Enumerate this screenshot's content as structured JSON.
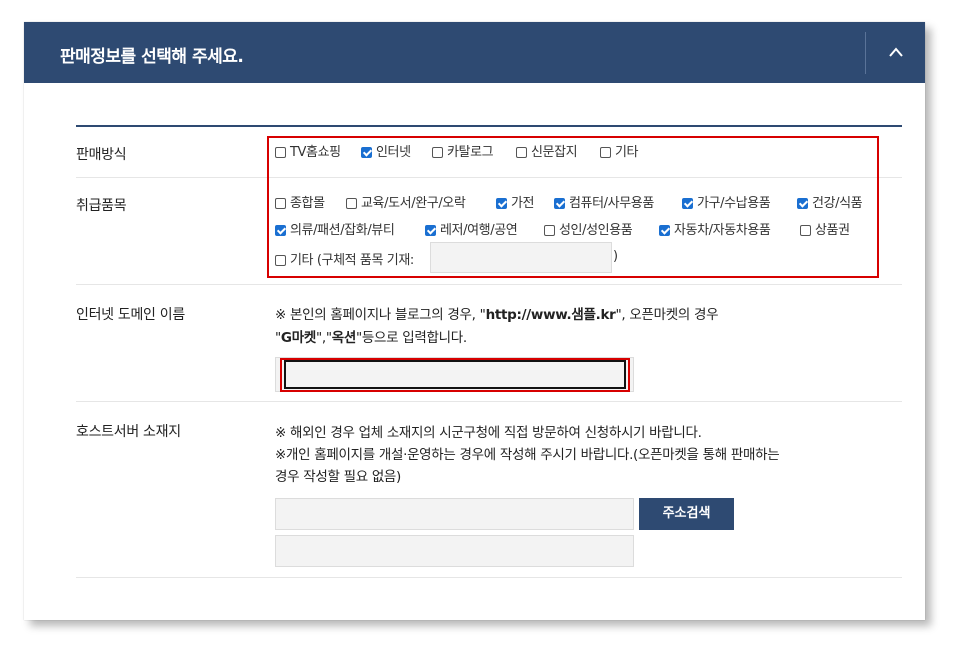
{
  "header": {
    "title": "판매정보를 선택해 주세요."
  },
  "sales_method": {
    "label": "판매방식",
    "options": [
      {
        "label": "TV홈쇼핑",
        "checked": false
      },
      {
        "label": "인터넷",
        "checked": true
      },
      {
        "label": "카탈로그",
        "checked": false
      },
      {
        "label": "신문잡지",
        "checked": false
      },
      {
        "label": "기타",
        "checked": false
      }
    ]
  },
  "products": {
    "label": "취급품목",
    "options": [
      {
        "label": "종합몰",
        "checked": false
      },
      {
        "label": "교육/도서/완구/오락",
        "checked": false
      },
      {
        "label": "가전",
        "checked": true
      },
      {
        "label": "컴퓨터/사무용품",
        "checked": true
      },
      {
        "label": "가구/수납용품",
        "checked": true
      },
      {
        "label": "건강/식품",
        "checked": true
      },
      {
        "label": "의류/패션/잡화/뷰티",
        "checked": true
      },
      {
        "label": "레저/여행/공연",
        "checked": true
      },
      {
        "label": "성인/성인용품",
        "checked": false
      },
      {
        "label": "자동차/자동차용품",
        "checked": true
      },
      {
        "label": "상품권",
        "checked": false
      }
    ],
    "other_label": "기타 (구체적 품목 기재:",
    "other_close": ")",
    "other_value": ""
  },
  "domain": {
    "label": "인터넷 도메인 이름",
    "note_line1_prefix": "※ 본인의 홈페이지나 블로그의 경우, \"",
    "note_line1_bold": "http://www.샘플.kr",
    "note_line1_suffix": "\", 오픈마켓의 경우",
    "note_line2_q1": "\"",
    "note_line2_bold1": "G마켓",
    "note_line2_mid": "\",\"",
    "note_line2_bold2": "옥션",
    "note_line2_suffix": "\"등으로 입력합니다.",
    "value": ""
  },
  "host": {
    "label": "호스트서버 소재지",
    "note1": "※ 해외인 경우 업체 소재지의 시군구청에 직접 방문하여 신청하시기 바랍니다.",
    "note2": "※개인 홈페이지를 개설·운영하는 경우에 작성해 주시기 바랍니다.(오픈마켓을 통해 판매하는",
    "note3": "경우 작성할 필요 없음)",
    "address1": "",
    "address2": "",
    "search_button": "주소검색"
  },
  "colors": {
    "header_bg": "#2e4a72",
    "highlight": "#d70000",
    "checkbox_checked": "#1a6fd1"
  }
}
